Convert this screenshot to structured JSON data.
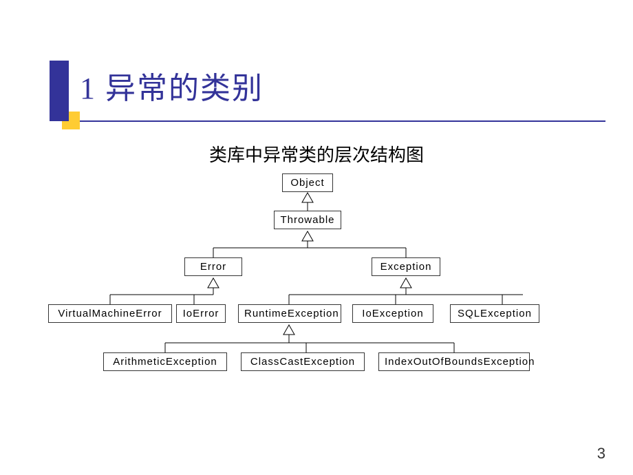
{
  "title": "1 异常的类别",
  "subtitle": "类库中异常类的层次结构图",
  "page_number": "3",
  "nodes": {
    "object": "Object",
    "throwable": "Throwable",
    "error": "Error",
    "exception": "Exception",
    "vm_error": "VirtualMachineError",
    "io_error": "IoError",
    "runtime_ex": "RuntimeException",
    "io_ex": "IoException",
    "sql_ex": "SQLException",
    "arith_ex": "ArithmeticException",
    "classcast_ex": "ClassCastException",
    "ioob_ex": "IndexOutOfBoundsException"
  }
}
